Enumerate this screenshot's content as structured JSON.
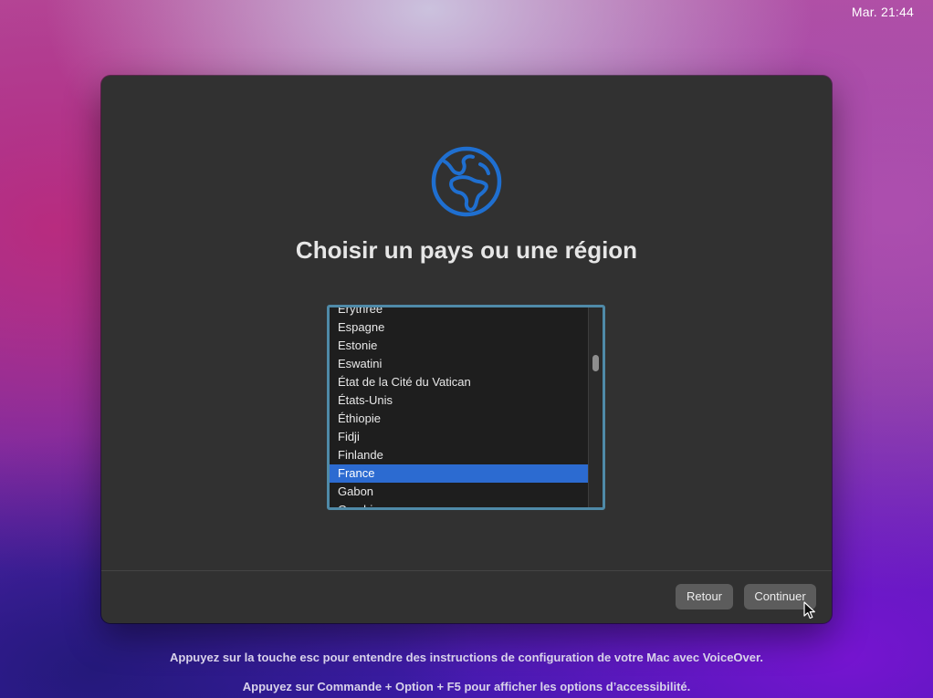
{
  "menubar": {
    "clock": "Mar. 21:44"
  },
  "setup": {
    "icon": "globe-icon",
    "accent_color": "#2c6bd1",
    "title": "Choisir un pays ou une région",
    "countries": [
      "Érythrée",
      "Espagne",
      "Estonie",
      "Eswatini",
      "État de la Cité du Vatican",
      "États-Unis",
      "Éthiopie",
      "Fidji",
      "Finlande",
      "France",
      "Gabon",
      "Gambie"
    ],
    "selected_country": "France",
    "buttons": {
      "back_label": "Retour",
      "continue_label": "Continuer"
    }
  },
  "footer": {
    "voiceover_hint": "Appuyez sur la touche esc pour entendre des instructions de configuration de votre Mac avec VoiceOver.",
    "accessibility_hint": "Appuyez sur Commande + Option + F5 pour afficher les options d’accessibilité."
  }
}
